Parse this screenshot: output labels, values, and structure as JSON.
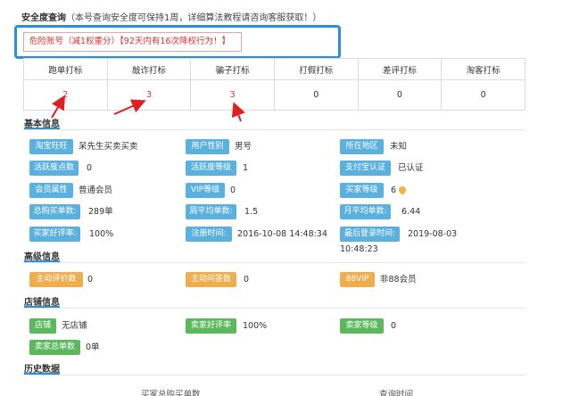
{
  "header": {
    "title": "安全度查询",
    "note": "（本号查询安全度可保持1周，详细算法教程请咨询客服获取！）"
  },
  "alert": {
    "text": "危险账号（减1权重分）【92天内有16次降权行为！】"
  },
  "stats": {
    "headers": [
      "跑单打标",
      "敲诈打标",
      "骗子打标",
      "打假打标",
      "差评打标",
      "淘客打标"
    ],
    "values": [
      "2",
      "3",
      "3",
      "0",
      "0",
      "0"
    ]
  },
  "sections": {
    "basic": "基本信息",
    "advanced": "高级信息",
    "shop": "店铺信息",
    "history": "历史数据"
  },
  "basic": {
    "wangwang_label": "淘宝旺旺",
    "wangwang_value": "呆先生买卖买卖",
    "gender_label": "用户性别",
    "gender_value": "男号",
    "region_label": "所在地区",
    "region_value": "未知",
    "activity_points_label": "活跃度点数",
    "activity_points_value": "0",
    "activity_level_label": "活跃度等级",
    "activity_level_value": "1",
    "alipay_label": "支付宝认证",
    "alipay_value": "已认证",
    "member_label": "会员属性",
    "member_value": "普通会员",
    "vip_label": "VIP等级",
    "vip_value": "0",
    "buyer_level_label": "买家等级",
    "buyer_level_value": "6",
    "total_orders_label": "总购买单数:",
    "total_orders_value": "289单",
    "weekly_avg_label": "周平均单数:",
    "weekly_avg_value": "1.5",
    "monthly_avg_label": "月平均单数:",
    "monthly_avg_value": "6.44",
    "good_rate_label": "买家好评率:",
    "good_rate_value": "100%",
    "register_label": "注册时间:",
    "register_value": "2016-10-08 14:48:34",
    "last_login_label": "最后登录时间:",
    "last_login_date": "2019-08-03",
    "last_login_time": "10:48:23"
  },
  "advanced": {
    "active_review_label": "主动评价数",
    "active_review_value": "0",
    "active_qa_label": "主动问答数",
    "active_qa_value": "0",
    "vip88_label": "88VIP",
    "vip88_value": "非88会员"
  },
  "shop": {
    "shop_label": "店铺",
    "shop_value": "无店铺",
    "seller_rate_label": "卖家好评率",
    "seller_rate_value": "100%",
    "seller_level_label": "卖家等级",
    "seller_level_value": "0",
    "seller_orders_label": "卖家总单数",
    "seller_orders_value": "0单"
  },
  "history": {
    "col1": "买家总购买单数",
    "col2": "查询时间"
  },
  "colors": {
    "accent_blue": "#2d8fd6",
    "badge_blue": "#5ab0de",
    "badge_orange": "#f0ad4e",
    "badge_green": "#5cb85c",
    "danger_red": "#e23030"
  }
}
